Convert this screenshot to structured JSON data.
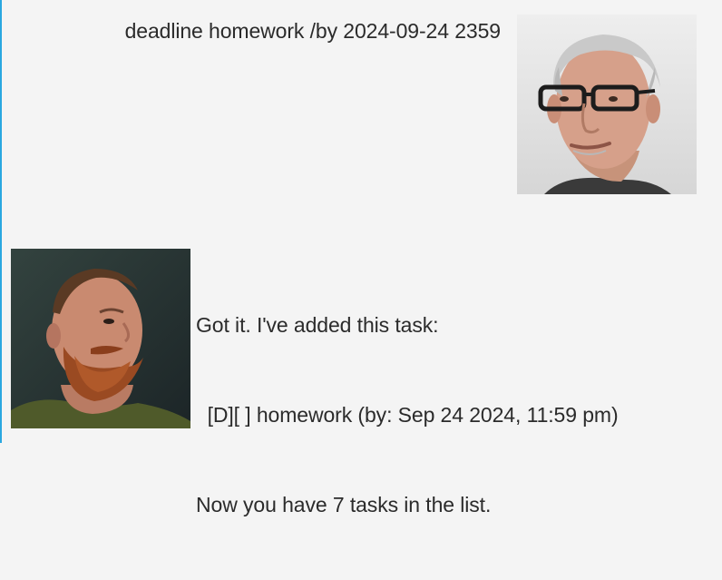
{
  "messages": {
    "user": {
      "text": "deadline homework /by 2024-09-24 2359",
      "avatar_icon": "user-avatar-photo"
    },
    "bot": {
      "lines": [
        "Got it. I've added this task:",
        "  [D][ ] homework (by: Sep 24 2024, 11:59 pm)",
        "Now you have 7 tasks in the list."
      ],
      "avatar_icon": "bot-avatar-photo"
    }
  },
  "colors": {
    "background": "#f4f4f4",
    "accent": "#2aa7e0",
    "text": "#2b2b2b"
  }
}
